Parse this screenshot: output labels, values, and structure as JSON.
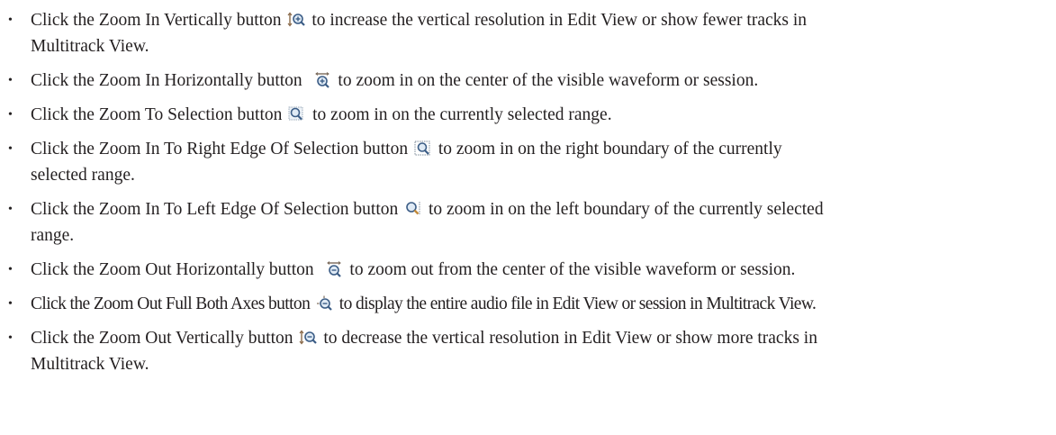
{
  "items": [
    {
      "icon": "zoom-in-vertically-icon",
      "before": "Click the Zoom In Vertically button",
      "line1": "to increase the vertical resolution in Edit View or show fewer tracks in",
      "line2": "Multitrack View."
    },
    {
      "icon": "zoom-in-horizontally-icon",
      "before": "Click the Zoom In Horizontally button",
      "line1": "to zoom in on the center of the visible waveform or session.",
      "line2": ""
    },
    {
      "icon": "zoom-to-selection-icon",
      "before": "Click the Zoom To Selection button",
      "line1": "to zoom in on the currently selected range.",
      "line2": ""
    },
    {
      "icon": "zoom-in-right-edge-icon",
      "before": "Click the Zoom In To Right Edge Of Selection button",
      "line1": "to zoom in on the right boundary of the currently",
      "line2": "selected range."
    },
    {
      "icon": "zoom-in-left-edge-icon",
      "before": "Click the Zoom In To Left Edge Of Selection button",
      "line1": "to zoom in on the left boundary of the currently selected",
      "line2": "range."
    },
    {
      "icon": "zoom-out-horizontally-icon",
      "before": "Click the Zoom Out Horizontally button",
      "line1": "to zoom out from the center of the visible waveform or session.",
      "line2": ""
    },
    {
      "icon": "zoom-out-full-both-axes-icon",
      "before": "Click the Zoom Out Full Both Axes button",
      "line1": "to display the entire audio file in Edit View or session in Multitrack View.",
      "line2": ""
    },
    {
      "icon": "zoom-out-vertically-icon",
      "before": "Click the Zoom Out Vertically button",
      "line1": "to decrease the vertical resolution in Edit View or show more tracks in",
      "line2": "Multitrack View."
    }
  ]
}
